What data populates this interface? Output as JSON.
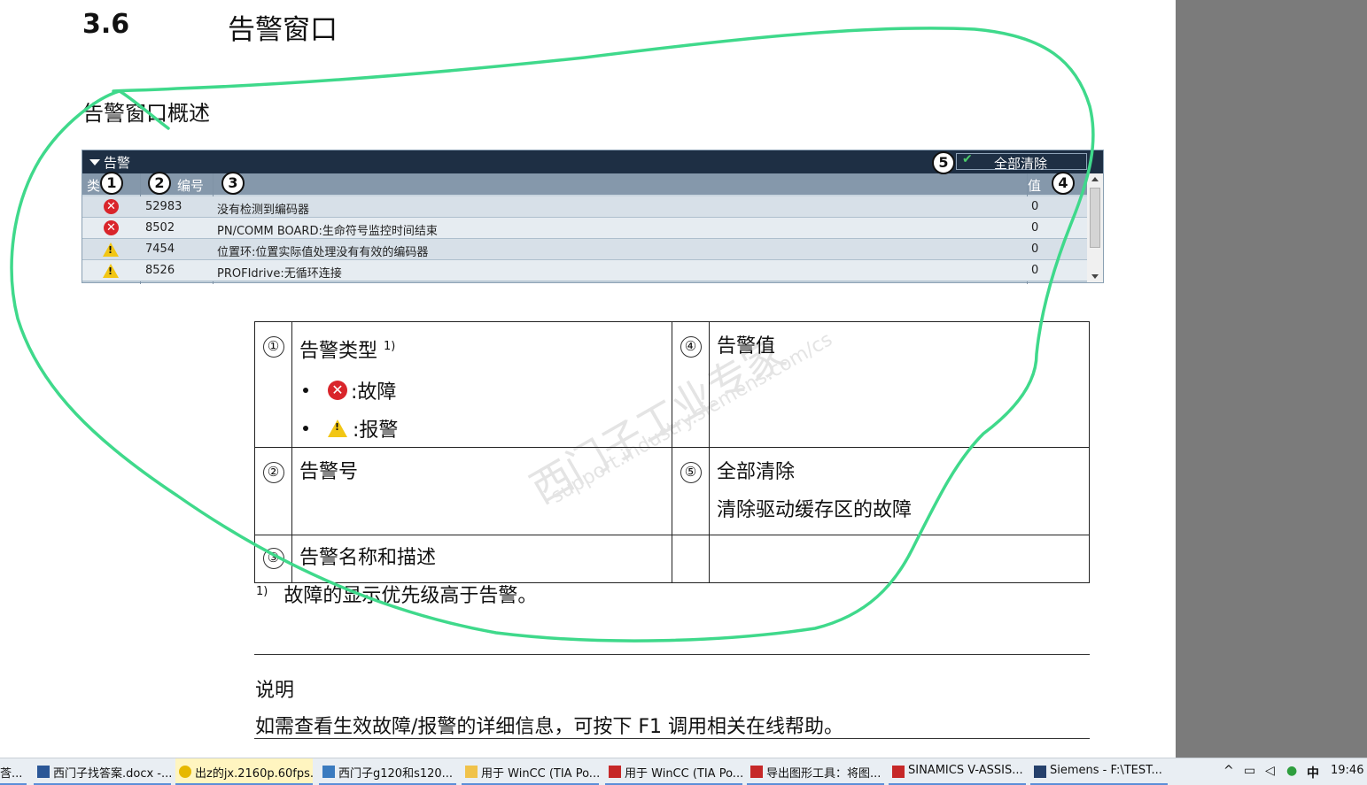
{
  "section": {
    "number": "3.6",
    "title": "告警窗口"
  },
  "subheading": "告警窗口概述",
  "alarm_panel": {
    "title": "告警",
    "clear_all": "全部清除",
    "columns": {
      "type": "类",
      "number": "编号",
      "value": "值"
    },
    "rows": [
      {
        "type": "error",
        "number": "52983",
        "description": "没有检测到编码器",
        "value": "0"
      },
      {
        "type": "error",
        "number": "8502",
        "description": "PN/COMM BOARD:生命符号监控时间结束",
        "value": "0"
      },
      {
        "type": "warning",
        "number": "7454",
        "description": "位置环:位置实际值处理没有有效的编码器",
        "value": "0"
      },
      {
        "type": "warning",
        "number": "8526",
        "description": "PROFIdrive:无循环连接",
        "value": "0"
      }
    ],
    "callouts": [
      "1",
      "2",
      "3",
      "4",
      "5"
    ]
  },
  "legend": {
    "items": [
      {
        "num": "①",
        "title": "告警类型",
        "sup": "1)",
        "bullets": [
          {
            "icon": "error",
            "text": ":故障"
          },
          {
            "icon": "warning",
            "text": ":报警"
          }
        ]
      },
      {
        "num": "②",
        "title": "告警号"
      },
      {
        "num": "③",
        "title": "告警名称和描述"
      },
      {
        "num": "④",
        "title": "告警值"
      },
      {
        "num": "⑤",
        "title": "全部清除",
        "detail": "清除驱动缓存区的故障"
      }
    ]
  },
  "footnote": {
    "mark": "1)",
    "text": "故障的显示优先级高于告警。"
  },
  "note": {
    "heading": "说明",
    "text": "如需查看生效故障/报警的详细信息，可按下 F1 调用相关在线帮助。"
  },
  "watermark": {
    "line1": "西门子工业专家",
    "line2": "support.industry.siemens.com/cs"
  },
  "taskbar": {
    "tasks": [
      {
        "label": "莟...",
        "icon": "app-icon"
      },
      {
        "label": "西门子找答案.docx -...",
        "icon": "word-icon"
      },
      {
        "label": "出z的jx.2160p.60fps...",
        "icon": "video-icon",
        "active": true
      },
      {
        "label": "西门子g120和s120...",
        "icon": "doc-icon"
      },
      {
        "label": "用于 WinCC (TIA Po...",
        "icon": "folder-icon"
      },
      {
        "label": "用于 WinCC (TIA Po...",
        "icon": "pdf-icon"
      },
      {
        "label": "导出图形工具：将图...",
        "icon": "pdf-icon"
      },
      {
        "label": "SINAMICS V-ASSIS...",
        "icon": "pdf-icon"
      },
      {
        "label": "Siemens  -  F:\\TEST...",
        "icon": "siemens-icon"
      }
    ],
    "tray": {
      "ime": "中",
      "time": "19:46"
    }
  },
  "colors": {
    "annotation": "#3fd98b",
    "panel_bar": "#1e2f44",
    "error": "#d9252b",
    "warning": "#f2c614"
  }
}
